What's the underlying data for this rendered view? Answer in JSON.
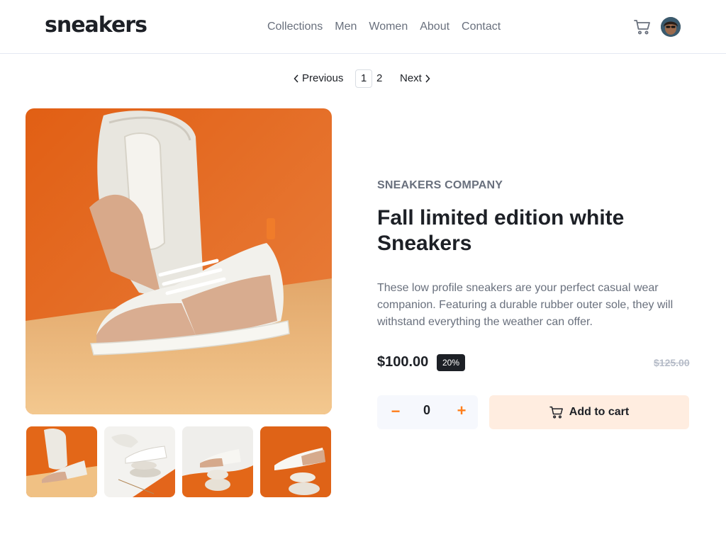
{
  "header": {
    "logo": "sneakers",
    "nav": [
      "Collections",
      "Men",
      "Women",
      "About",
      "Contact"
    ],
    "cart_icon": "cart-icon",
    "avatar_icon": "user-avatar"
  },
  "pagination": {
    "previous": "Previous",
    "pages": [
      "1",
      "2"
    ],
    "current": "1",
    "next": "Next"
  },
  "product": {
    "company": "SNEAKERS COMPANY",
    "title": "Fall limited edition white Sneakers",
    "description": "These low profile sneakers are your perfect casual wear companion. Featuring a durable rubber outer sole, they will withstand everything the weather can offer.",
    "price": "$100.00",
    "discount": "20%",
    "old_price": "$125.00",
    "quantity": "0",
    "minus": "−",
    "plus": "+",
    "add_to_cart": "Add to cart"
  },
  "colors": {
    "accent": "#ff7e1b",
    "accent_light": "#ffede0",
    "dark": "#1d2026",
    "muted": "#69707d",
    "background": "#ffffff"
  }
}
